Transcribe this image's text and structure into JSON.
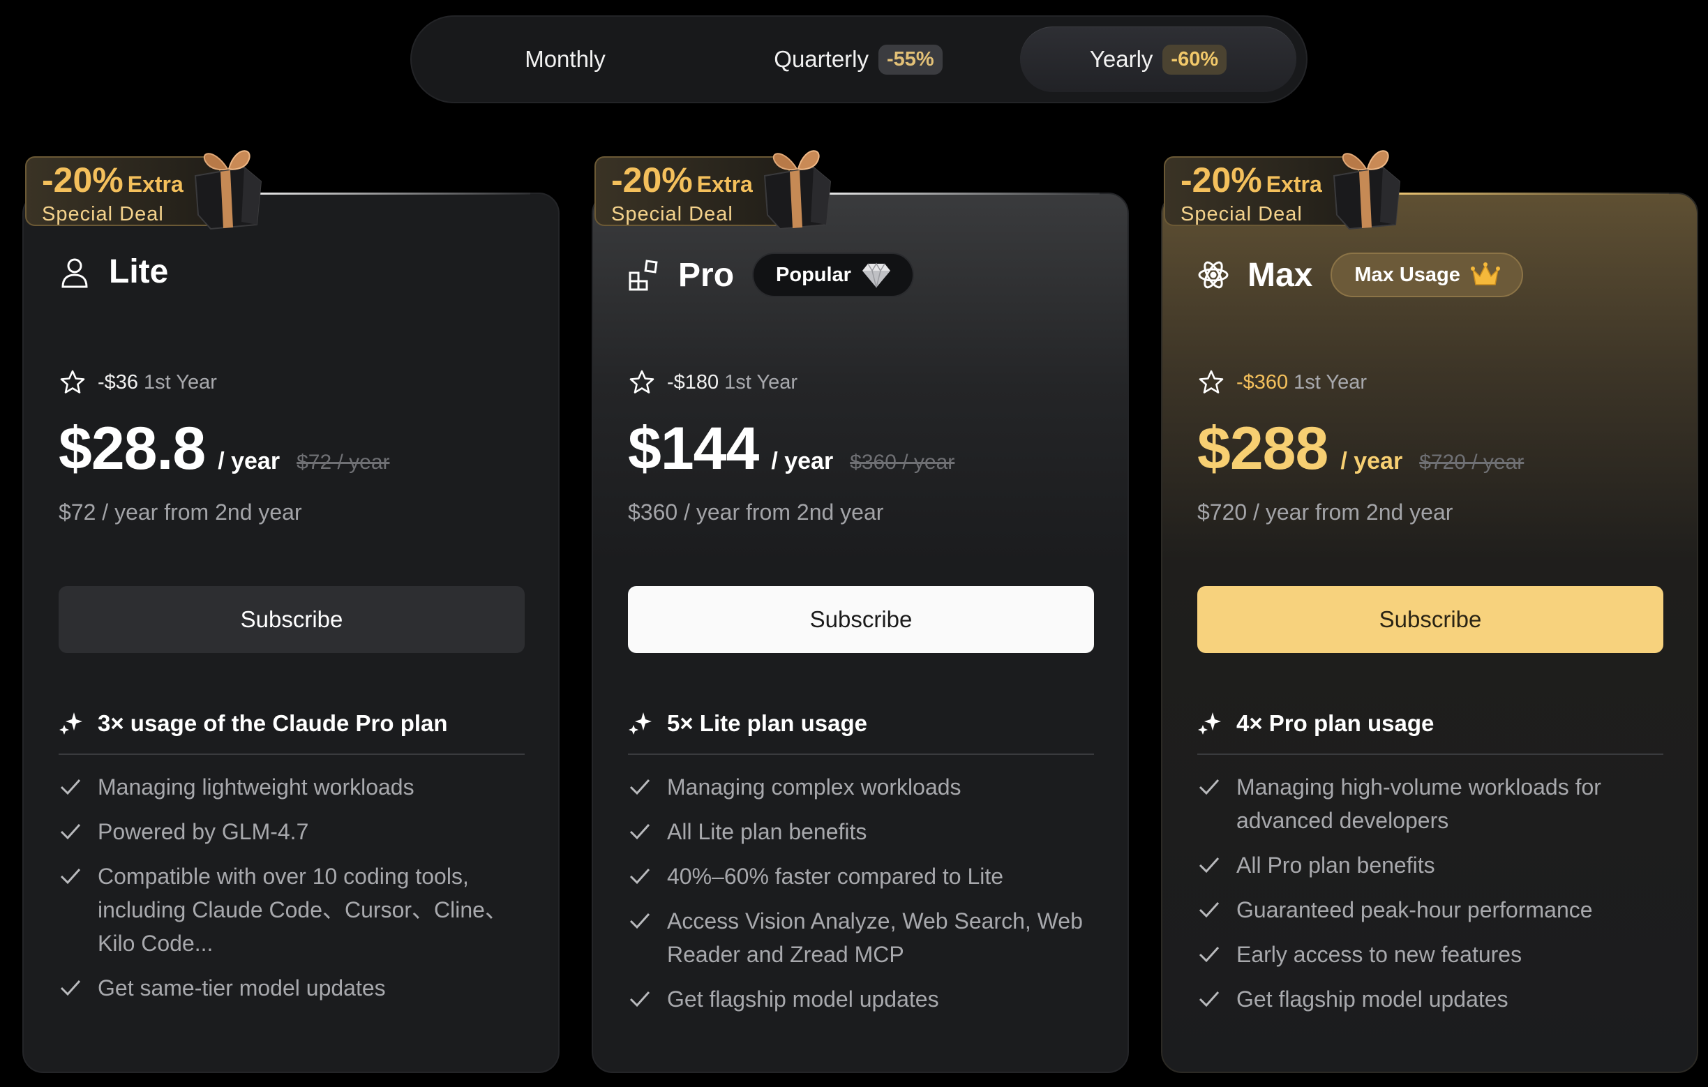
{
  "toggle": {
    "options": [
      {
        "label": "Monthly",
        "badge": ""
      },
      {
        "label": "Quarterly",
        "badge": "-55%"
      },
      {
        "label": "Yearly",
        "badge": "-60%"
      }
    ],
    "selected": "Yearly"
  },
  "deal": {
    "percent": "-20%",
    "extra": "Extra",
    "label": "Special Deal"
  },
  "plans": [
    {
      "name": "Lite",
      "icon": "user-icon",
      "badge": "",
      "save_amount": "-$36",
      "save_period": "1st Year",
      "price": "$28.8",
      "per": "/ year",
      "original": "$72 / year",
      "renewal": "$72 / year from 2nd year",
      "subscribe": "Subscribe",
      "usage": "3× usage of the Claude Pro plan",
      "features": [
        "Managing lightweight workloads",
        "Powered by GLM-4.7",
        "Compatible with over 10 coding tools, including Claude Code、Cursor、Cline、Kilo Code...",
        "Get same-tier model updates"
      ]
    },
    {
      "name": "Pro",
      "icon": "blocks-icon",
      "badge": "Popular",
      "badge_icon": "diamond-icon",
      "save_amount": "-$180",
      "save_period": "1st Year",
      "price": "$144",
      "per": "/ year",
      "original": "$360 / year",
      "renewal": "$360 / year from 2nd year",
      "subscribe": "Subscribe",
      "usage": "5× Lite plan usage",
      "features": [
        "Managing complex workloads",
        "All Lite plan benefits",
        "40%–60% faster compared to Lite",
        "Access Vision Analyze, Web Search, Web Reader and Zread MCP",
        "Get flagship model updates"
      ]
    },
    {
      "name": "Max",
      "icon": "atom-icon",
      "badge": "Max Usage",
      "badge_icon": "crown-icon",
      "save_amount": "-$360",
      "save_period": "1st Year",
      "price": "$288",
      "per": "/ year",
      "original": "$720 / year",
      "renewal": "$720 / year from 2nd year",
      "subscribe": "Subscribe",
      "usage": "4× Pro plan usage",
      "features": [
        "Managing high-volume workloads for advanced developers",
        "All Pro plan benefits",
        "Guaranteed peak-hour performance",
        "Early access to new features",
        "Get flagship model updates"
      ]
    }
  ],
  "colors": {
    "gold": "#f7cf72",
    "deal_gold": "#f4c05c",
    "background": "#000000",
    "card": "#1b1c1e"
  }
}
